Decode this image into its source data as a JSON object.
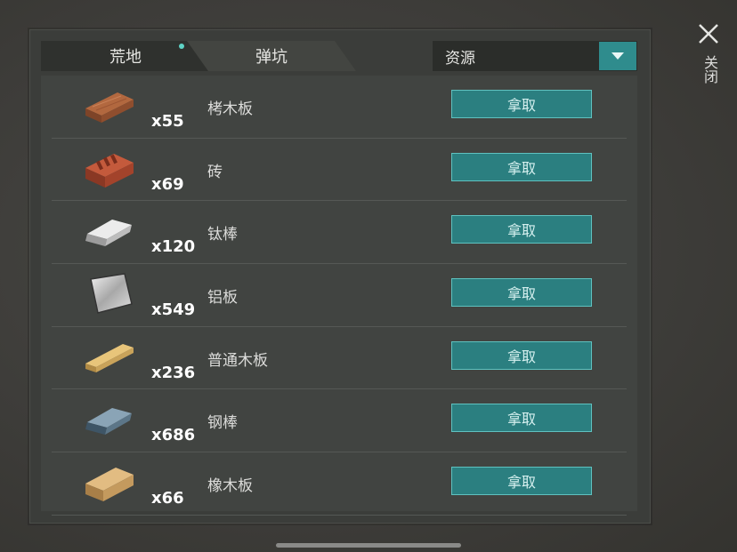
{
  "tabs": [
    {
      "label": "荒地",
      "has_notification": true
    },
    {
      "label": "弹坑",
      "has_notification": false
    }
  ],
  "filter": {
    "selected": "资源"
  },
  "close": {
    "label": "关闭"
  },
  "items": [
    {
      "icon": "wood-plank-icon",
      "count": "x55",
      "name": "栲木板",
      "action": "拿取"
    },
    {
      "icon": "brick-icon",
      "count": "x69",
      "name": "砖",
      "action": "拿取"
    },
    {
      "icon": "titanium-bar-icon",
      "count": "x120",
      "name": "钛棒",
      "action": "拿取"
    },
    {
      "icon": "aluminum-plate-icon",
      "count": "x549",
      "name": "铝板",
      "action": "拿取"
    },
    {
      "icon": "plank-icon",
      "count": "x236",
      "name": "普通木板",
      "action": "拿取"
    },
    {
      "icon": "steel-bar-icon",
      "count": "x686",
      "name": "钢棒",
      "action": "拿取"
    },
    {
      "icon": "oak-plank-icon",
      "count": "x66",
      "name": "橡木板",
      "action": "拿取"
    }
  ],
  "colors": {
    "accent": "#2f8c8d",
    "button_border": "#5fc2c0",
    "dot": "#5fd3c6"
  }
}
